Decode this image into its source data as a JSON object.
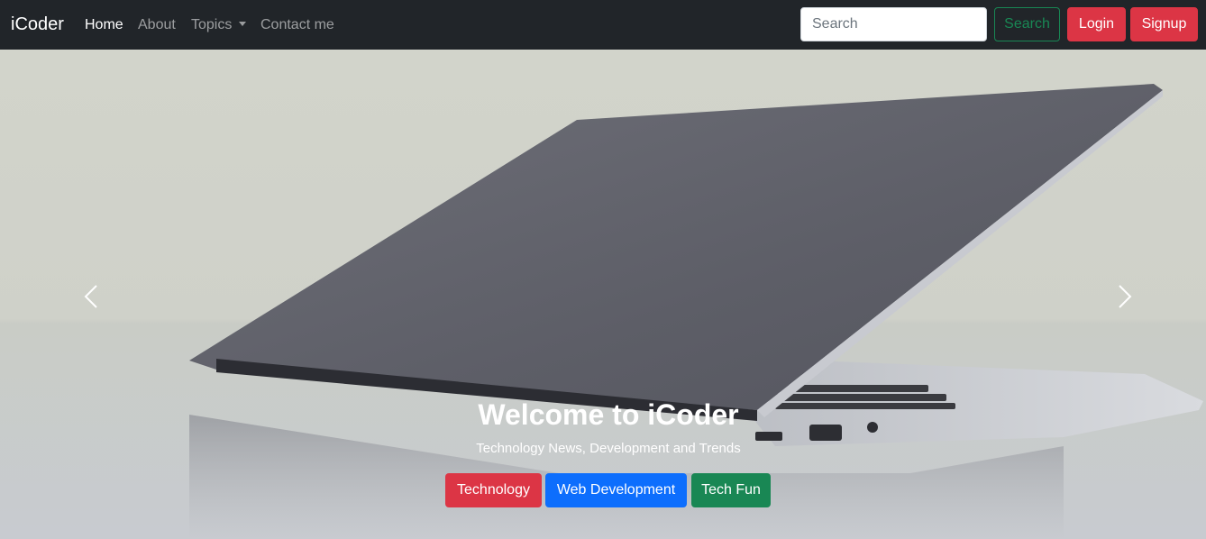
{
  "navbar": {
    "brand": "iCoder",
    "links": [
      "Home",
      "About",
      "Topics",
      "Contact me"
    ],
    "search_placeholder": "Search",
    "search_button": "Search",
    "login_button": "Login",
    "signup_button": "Signup"
  },
  "carousel": {
    "title": "Welcome to iCoder",
    "subtitle": "Technology News, Development and Trends",
    "buttons": [
      "Technology",
      "Web Development",
      "Tech Fun"
    ],
    "prev_icon": "chevron-left-icon",
    "next_icon": "chevron-right-icon"
  },
  "colors": {
    "navbar_bg": "#212529",
    "danger": "#dc3545",
    "primary": "#0d6efd",
    "success": "#198754"
  }
}
